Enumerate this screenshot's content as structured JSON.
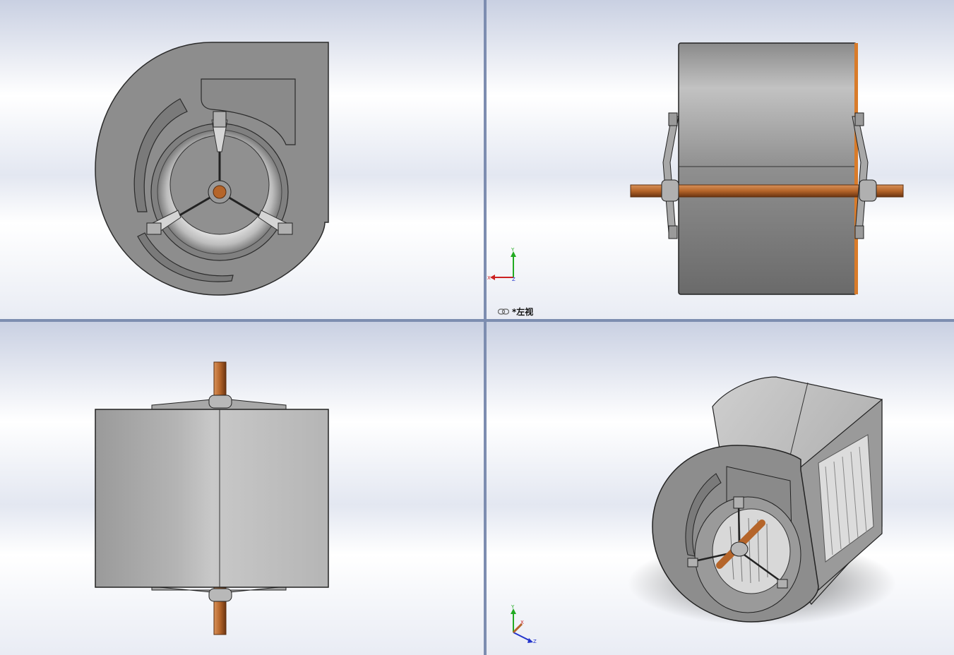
{
  "viewports": {
    "top_left": {
      "name": "front-view"
    },
    "top_right": {
      "name": "left-view",
      "label": "*左视"
    },
    "bottom_left": {
      "name": "top-view"
    },
    "bottom_right": {
      "name": "isometric-view"
    }
  },
  "triad_front": {
    "x": "X",
    "y": "Y",
    "z": "Z"
  },
  "triad_iso": {
    "x": "X",
    "y": "Y",
    "z": "Z"
  },
  "colors": {
    "housing": "#8d8d8d",
    "housing_dark": "#5f5f5f",
    "shaft": "#b5652a",
    "background_top": "#c9d0e2",
    "divider": "#7d8db0",
    "axis_x": "#cc2222",
    "axis_y": "#22aa22",
    "axis_z": "#2233cc"
  },
  "icons": [
    "link-icon",
    "triad-icon"
  ]
}
